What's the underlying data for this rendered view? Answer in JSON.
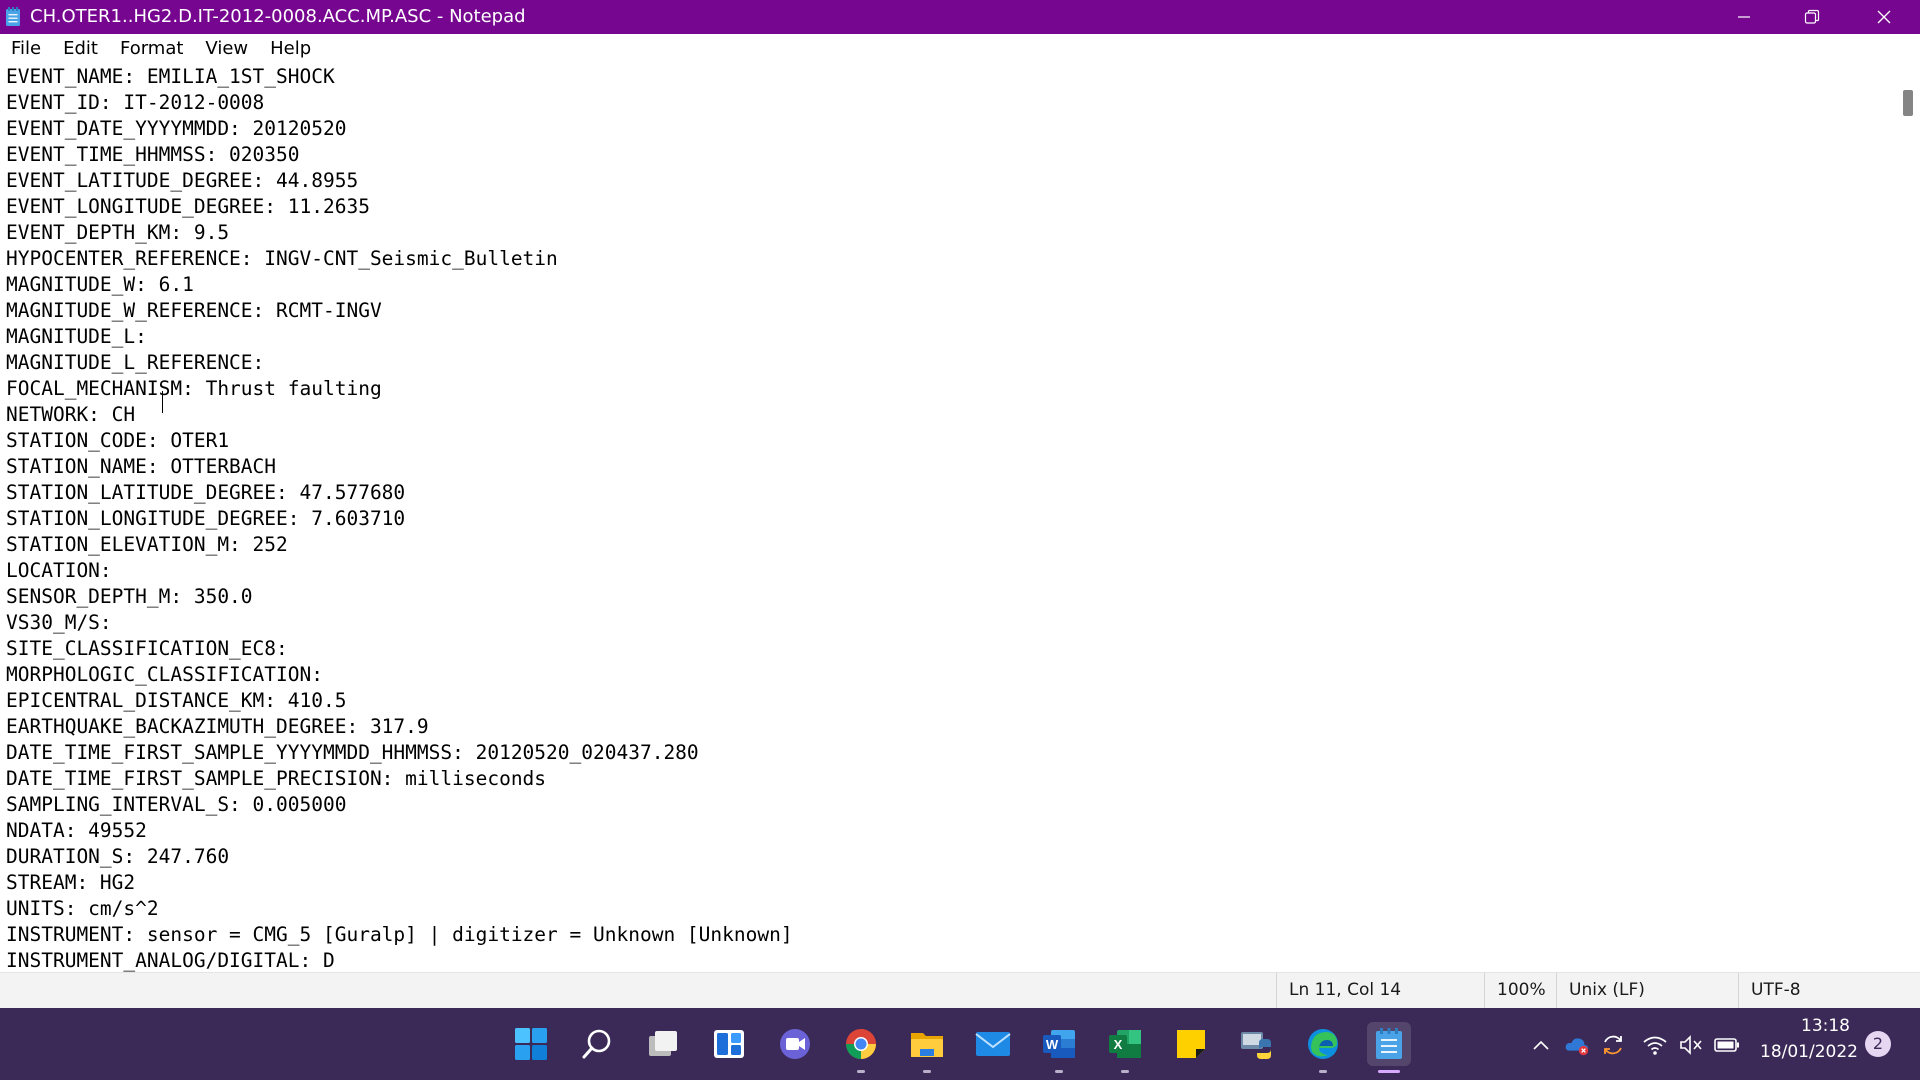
{
  "window": {
    "title": "CH.OTER1..HG2.D.IT-2012-0008.ACC.MP.ASC - Notepad",
    "title_bg": "#76068f"
  },
  "menu": [
    "File",
    "Edit",
    "Format",
    "View",
    "Help"
  ],
  "editor": {
    "lines": [
      "EVENT_NAME: EMILIA_1ST_SHOCK",
      "EVENT_ID: IT-2012-0008",
      "EVENT_DATE_YYYYMMDD: 20120520",
      "EVENT_TIME_HHMMSS: 020350",
      "EVENT_LATITUDE_DEGREE: 44.8955",
      "EVENT_LONGITUDE_DEGREE: 11.2635",
      "EVENT_DEPTH_KM: 9.5",
      "HYPOCENTER_REFERENCE: INGV-CNT_Seismic_Bulletin",
      "MAGNITUDE_W: 6.1",
      "MAGNITUDE_W_REFERENCE: RCMT-INGV",
      "MAGNITUDE_L: ",
      "MAGNITUDE_L_REFERENCE:",
      "FOCAL_MECHANISM: Thrust faulting",
      "NETWORK: CH",
      "STATION_CODE: OTER1",
      "STATION_NAME: OTTERBACH",
      "STATION_LATITUDE_DEGREE: 47.577680",
      "STATION_LONGITUDE_DEGREE: 7.603710",
      "STATION_ELEVATION_M: 252",
      "LOCATION:",
      "SENSOR_DEPTH_M: 350.0",
      "VS30_M/S:",
      "SITE_CLASSIFICATION_EC8:",
      "MORPHOLOGIC_CLASSIFICATION:",
      "EPICENTRAL_DISTANCE_KM: 410.5",
      "EARTHQUAKE_BACKAZIMUTH_DEGREE: 317.9",
      "DATE_TIME_FIRST_SAMPLE_YYYYMMDD_HHMMSS: 20120520_020437.280",
      "DATE_TIME_FIRST_SAMPLE_PRECISION: milliseconds",
      "SAMPLING_INTERVAL_S: 0.005000",
      "NDATA: 49552",
      "DURATION_S: 247.760",
      "STREAM: HG2",
      "UNITS: cm/s^2",
      "INSTRUMENT: sensor = CMG_5 [Guralp] | digitizer = Unknown [Unknown]",
      "INSTRUMENT_ANALOG/DIGITAL: D"
    ]
  },
  "status": {
    "position": "Ln 11, Col 14",
    "zoom": "100%",
    "line_ending": "Unix (LF)",
    "encoding": "UTF-8"
  },
  "taskbar": {
    "icons": [
      "start-icon",
      "search-icon",
      "task-view-icon",
      "widgets-icon",
      "teams-chat-icon",
      "chrome-icon",
      "file-explorer-icon",
      "mail-icon",
      "word-icon",
      "excel-icon",
      "sticky-notes-icon",
      "python-icon",
      "edge-icon",
      "notepad-icon"
    ],
    "colors": {
      "bg": "#3b2a57",
      "accent": "#d7a9ff"
    }
  },
  "tray": {
    "time": "13:18",
    "date": "18/01/2022",
    "notifications": "2"
  }
}
